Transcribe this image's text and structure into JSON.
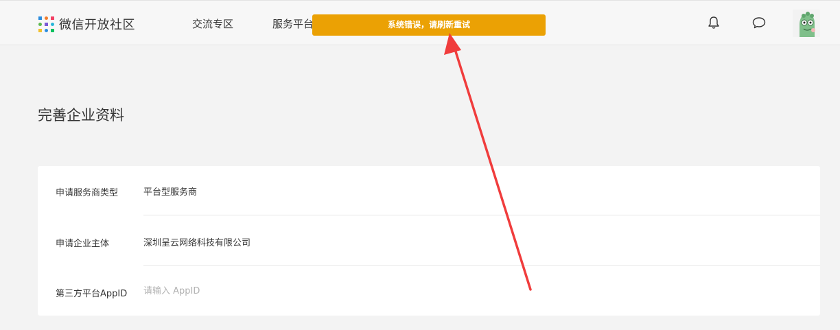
{
  "header": {
    "logo_text": "微信开放社区",
    "nav": [
      {
        "label": "交流专区"
      },
      {
        "label": "服务平台"
      }
    ],
    "avatar_alt": "avatar"
  },
  "toast": {
    "message": "系统错误，请刷新重试",
    "color": "#eba104"
  },
  "main": {
    "title": "完善企业资料",
    "form": {
      "rows": [
        {
          "label": "申请服务商类型",
          "value": "平台型服务商"
        },
        {
          "label": "申请企业主体",
          "value": "深圳呈云网络科技有限公司"
        },
        {
          "label": "第三方平台AppID",
          "placeholder": "请输入 AppID",
          "value": ""
        }
      ]
    }
  },
  "annotation": {
    "color": "#f03c3c"
  }
}
